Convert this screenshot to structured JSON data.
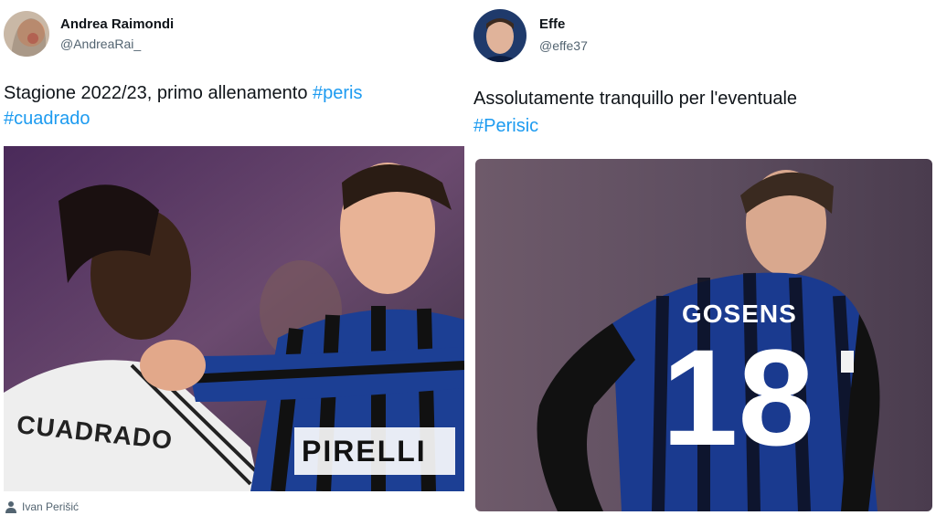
{
  "left_tweet": {
    "author_name": "Andrea Raimondi",
    "author_handle": "@AndreaRai_",
    "text_line1": "Stagione 2022/23, primo allenamento ",
    "hashtag1": "#peris",
    "hashtag2": "#cuadrado",
    "photo_jersey_name": "CUADRADO",
    "photo_sponsor": "PIRELLI",
    "photo_credit": "Ivan Perišić"
  },
  "right_tweet": {
    "author_name": "Effe",
    "author_handle": "@effe37",
    "text_line1": "Assolutamente tranquillo per l'eventuale",
    "hashtag1": "#Perisic",
    "photo_jersey_name": "GOSENS",
    "photo_jersey_number": "18"
  },
  "icons": {
    "credit_icon": "person-icon"
  },
  "colors": {
    "hashtag": "#1d9bf0",
    "text": "#0f1419",
    "muted": "#536471",
    "inter_blue": "#1c3f94",
    "inter_black": "#111111"
  }
}
